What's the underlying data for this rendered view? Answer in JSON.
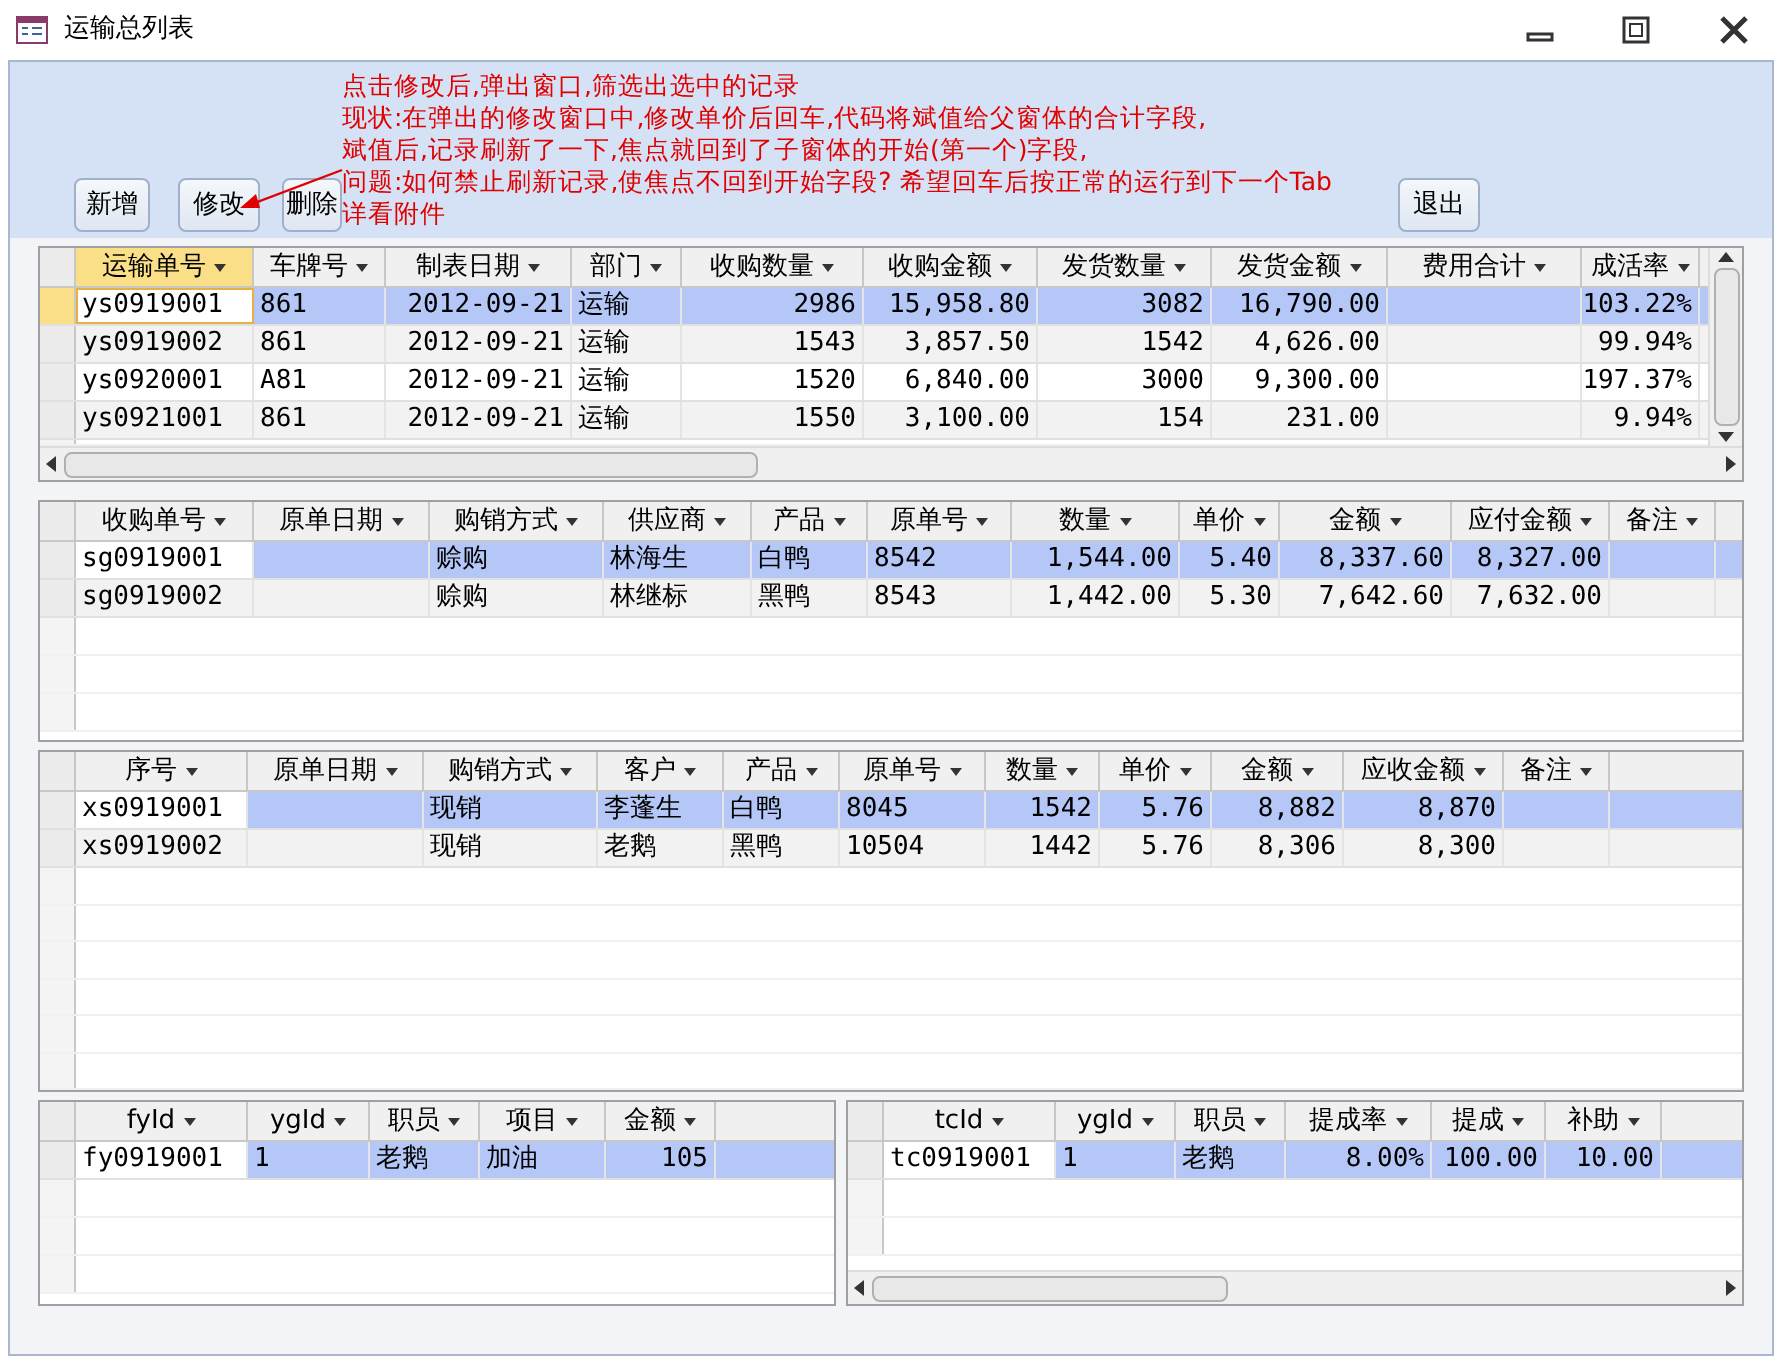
{
  "window": {
    "title": "运输总列表"
  },
  "buttons": [
    {
      "label": "新增"
    },
    {
      "label": "修改"
    },
    {
      "label": "删除"
    },
    {
      "label": "退出"
    }
  ],
  "note": [
    "点击修改后,弹出窗口,筛选出选中的记录",
    "现状:在弹出的修改窗口中,修改单价后回车,代码将斌值给父窗体的合计字段,",
    "斌值后,记录刷新了一下,焦点就回到了子窗体的开始(第一个)字段,",
    "问题:如何禁止刷新记录,使焦点不回到开始字段?  希望回车后按正常的运行到下一个Tab",
    "详看附件"
  ],
  "grids": [
    {
      "columns": [
        {
          "label": "运输单号",
          "selected": true
        },
        {
          "label": "车牌号",
          "selected": false
        },
        {
          "label": "制表日期",
          "selected": false
        },
        {
          "label": "部门",
          "selected": false
        },
        {
          "label": "收购数量",
          "selected": false
        },
        {
          "label": "收购金额",
          "selected": false
        },
        {
          "label": "发货数量",
          "selected": false
        },
        {
          "label": "发货金额",
          "selected": false
        },
        {
          "label": "费用合计",
          "selected": false
        },
        {
          "label": "成活率",
          "selected": false
        }
      ],
      "rows": [
        {
          "selected": true,
          "cells": [
            "ys0919001",
            "861",
            "2012-09-21",
            "运输",
            "2986",
            "15,958.80",
            "3082",
            "16,790.00",
            "",
            "103.22%"
          ]
        },
        {
          "selected": false,
          "cells": [
            "ys0919002",
            "861",
            "2012-09-21",
            "运输",
            "1543",
            "3,857.50",
            "1542",
            "4,626.00",
            "",
            "99.94%"
          ]
        },
        {
          "selected": false,
          "cells": [
            "ys0920001",
            "A81",
            "2012-09-21",
            "运输",
            "1520",
            "6,840.00",
            "3000",
            "9,300.00",
            "",
            "197.37%"
          ]
        },
        {
          "selected": false,
          "cells": [
            "ys0921001",
            "861",
            "2012-09-21",
            "运输",
            "1550",
            "3,100.00",
            "154",
            "231.00",
            "",
            "9.94%"
          ]
        }
      ]
    },
    {
      "columns": [
        {
          "label": "收购单号"
        },
        {
          "label": "原单日期"
        },
        {
          "label": "购销方式"
        },
        {
          "label": "供应商"
        },
        {
          "label": "产品"
        },
        {
          "label": "原单号"
        },
        {
          "label": "数量"
        },
        {
          "label": "单价"
        },
        {
          "label": "金额"
        },
        {
          "label": "应付金额"
        },
        {
          "label": "备注"
        }
      ],
      "rows": [
        {
          "selected": true,
          "cells": [
            "sg0919001",
            "",
            "赊购",
            "林海生",
            "白鸭",
            "8542",
            "1,544.00",
            "5.40",
            "8,337.60",
            "8,327.00",
            ""
          ]
        },
        {
          "selected": false,
          "cells": [
            "sg0919002",
            "",
            "赊购",
            "林继标",
            "黑鸭",
            "8543",
            "1,442.00",
            "5.30",
            "7,642.60",
            "7,632.00",
            ""
          ]
        }
      ]
    },
    {
      "columns": [
        {
          "label": "序号"
        },
        {
          "label": "原单日期"
        },
        {
          "label": "购销方式"
        },
        {
          "label": "客户"
        },
        {
          "label": "产品"
        },
        {
          "label": "原单号"
        },
        {
          "label": "数量"
        },
        {
          "label": "单价"
        },
        {
          "label": "金额"
        },
        {
          "label": "应收金额"
        },
        {
          "label": "备注"
        }
      ],
      "rows": [
        {
          "selected": true,
          "cells": [
            "xs0919001",
            "",
            "现销",
            "李蓬生",
            "白鸭",
            "8045",
            "1542",
            "5.76",
            "8,882",
            "8,870",
            ""
          ]
        },
        {
          "selected": false,
          "cells": [
            "xs0919002",
            "",
            "现销",
            "老鹅",
            "黑鸭",
            "10504",
            "1442",
            "5.76",
            "8,306",
            "8,300",
            ""
          ]
        }
      ]
    },
    {
      "columns": [
        {
          "label": "fyId"
        },
        {
          "label": "ygId"
        },
        {
          "label": "职员"
        },
        {
          "label": "项目"
        },
        {
          "label": "金额"
        }
      ],
      "rows": [
        {
          "selected": true,
          "cells": [
            "fy0919001",
            "1",
            "老鹅",
            "加油",
            "105"
          ]
        }
      ]
    },
    {
      "columns": [
        {
          "label": "tcId"
        },
        {
          "label": "ygId"
        },
        {
          "label": "职员"
        },
        {
          "label": "提成率"
        },
        {
          "label": "提成"
        },
        {
          "label": "补助"
        }
      ],
      "rows": [
        {
          "selected": true,
          "cells": [
            "tc0919001",
            "1",
            "老鹅",
            "8.00%",
            "100.00",
            "10.00"
          ]
        }
      ]
    }
  ]
}
